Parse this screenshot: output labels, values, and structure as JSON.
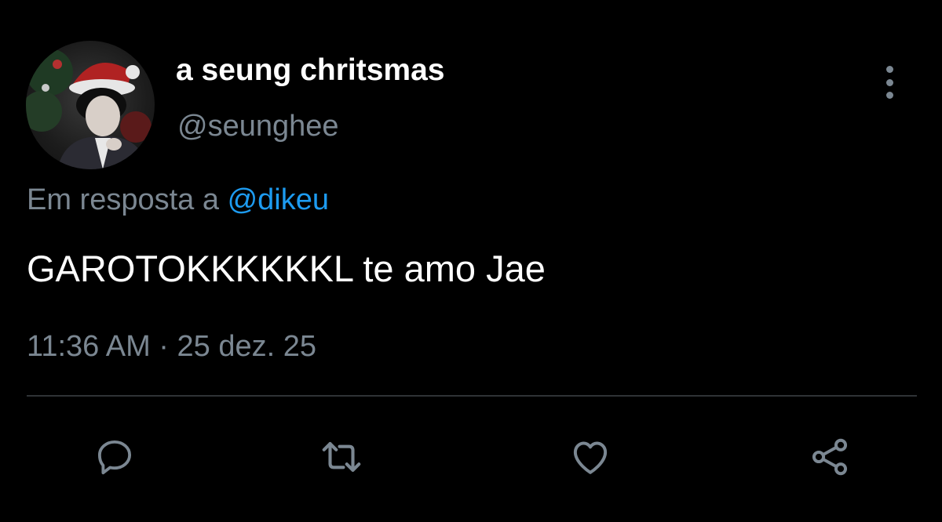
{
  "tweet": {
    "display_name": "a seung chritsmas",
    "handle": "@seunghee",
    "reply_prefix": "Em resposta a ",
    "reply_mention": "@dikeu",
    "text": "GAROTOKKKKKKL te amo Jae",
    "time": "11:36 AM",
    "separator": " · ",
    "date": "25 dez. 25"
  },
  "icons": {
    "more": "more-vertical-icon",
    "reply": "reply-icon",
    "retweet": "retweet-icon",
    "like": "heart-icon",
    "share": "share-icon"
  },
  "colors": {
    "background": "#000000",
    "text_primary": "#ffffff",
    "text_secondary": "#7b8792",
    "mention": "#1d9bf0",
    "divider": "#2f3336"
  }
}
